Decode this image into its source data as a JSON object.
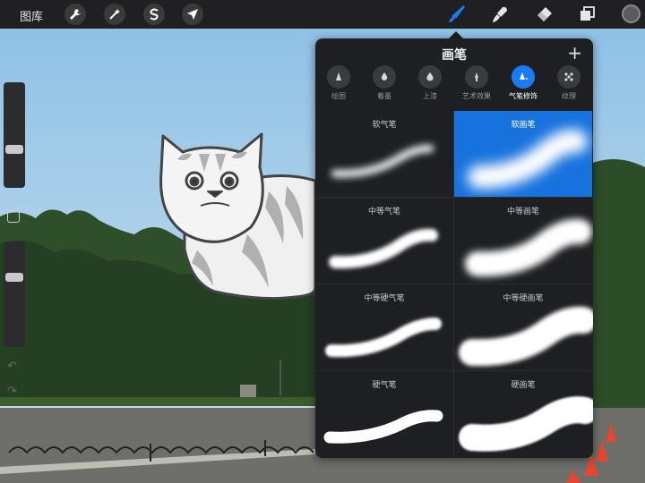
{
  "toolbar": {
    "gallery_label": "图库",
    "left_tools": [
      "wrench-icon",
      "magic-wand-icon",
      "selection-s-icon",
      "transform-arrow-icon"
    ],
    "right_tools": [
      "brush-icon",
      "smudge-icon",
      "eraser-icon",
      "layers-icon"
    ],
    "active_tool": "brush-icon",
    "accent_color": "#1a7cf5",
    "current_color": "#5c5c5c"
  },
  "sidebar": {
    "size_slider_level": 0.35,
    "opacity_slider_level": 0.68,
    "undo_glyph": "↶",
    "redo_glyph": "↷"
  },
  "brush_panel": {
    "title": "画笔",
    "add_glyph": "+",
    "categories": [
      {
        "label": "绘图",
        "icon": "pencil-tip-icon"
      },
      {
        "label": "着墨",
        "icon": "ink-drop-icon"
      },
      {
        "label": "上漆",
        "icon": "paint-drop-icon"
      },
      {
        "label": "艺术效果",
        "icon": "art-brush-icon"
      },
      {
        "label": "气笔修饰",
        "icon": "airbrush-icon"
      },
      {
        "label": "纹理",
        "icon": "texture-dots-icon"
      }
    ],
    "active_category": 4,
    "brushes": [
      {
        "label": "软气笔"
      },
      {
        "label": "软画笔"
      },
      {
        "label": "中等气笔"
      },
      {
        "label": "中等画笔"
      },
      {
        "label": "中等硬气笔"
      },
      {
        "label": "中等硬画笔"
      },
      {
        "label": "硬气笔"
      },
      {
        "label": "硬画笔"
      }
    ],
    "selected_brush": 1
  }
}
